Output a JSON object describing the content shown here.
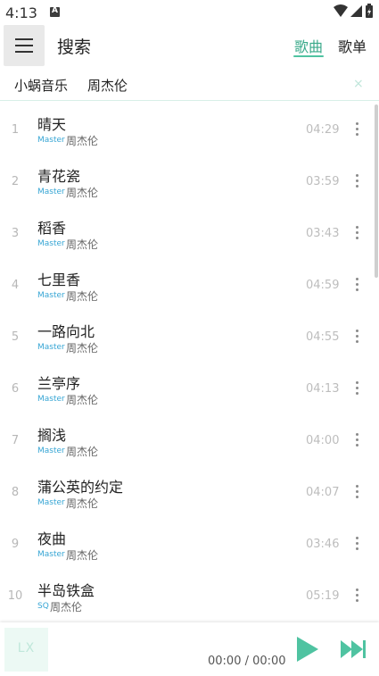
{
  "status_bar": {
    "time": "4:13",
    "icons": [
      "notification-a-icon",
      "wifi-icon",
      "signal-icon",
      "battery-icon"
    ]
  },
  "header": {
    "title": "搜索",
    "tabs": [
      {
        "label": "歌曲",
        "active": true
      },
      {
        "label": "歌单",
        "active": false
      }
    ]
  },
  "source_bar": {
    "source": "小蜗音乐",
    "keyword": "周杰伦",
    "clear_icon": "×"
  },
  "songs": [
    {
      "index": "1",
      "name": "晴天",
      "quality": "Master",
      "singer": "周杰伦",
      "duration": "04:29"
    },
    {
      "index": "2",
      "name": "青花瓷",
      "quality": "Master",
      "singer": "周杰伦",
      "duration": "03:59"
    },
    {
      "index": "3",
      "name": "稻香",
      "quality": "Master",
      "singer": "周杰伦",
      "duration": "03:43"
    },
    {
      "index": "4",
      "name": "七里香",
      "quality": "Master",
      "singer": "周杰伦",
      "duration": "04:59"
    },
    {
      "index": "5",
      "name": "一路向北",
      "quality": "Master",
      "singer": "周杰伦",
      "duration": "04:55"
    },
    {
      "index": "6",
      "name": "兰亭序",
      "quality": "Master",
      "singer": "周杰伦",
      "duration": "04:13"
    },
    {
      "index": "7",
      "name": "搁浅",
      "quality": "Master",
      "singer": "周杰伦",
      "duration": "04:00"
    },
    {
      "index": "8",
      "name": "蒲公英的约定",
      "quality": "Master",
      "singer": "周杰伦",
      "duration": "04:07"
    },
    {
      "index": "9",
      "name": "夜曲",
      "quality": "Master",
      "singer": "周杰伦",
      "duration": "03:46"
    },
    {
      "index": "10",
      "name": "半岛铁盒",
      "quality": "SQ",
      "singer": "周杰伦",
      "duration": "05:19"
    }
  ],
  "player": {
    "cover_label": "LX",
    "time": "00:00 / 00:00"
  },
  "colors": {
    "accent": "#4fc3a1",
    "quality": "#36a5d4",
    "index": "#b7b7b7",
    "duration": "#bdbdbd"
  }
}
